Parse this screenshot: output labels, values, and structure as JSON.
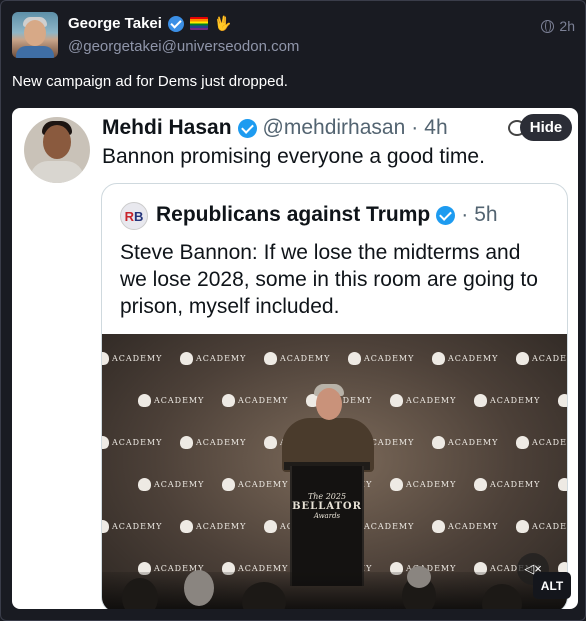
{
  "post": {
    "display_name": "George Takei",
    "handle": "@georgetakei@universeodon.com",
    "time": "2h",
    "text": "New campaign ad for Dems just dropped.",
    "icons": [
      "verified-badge-icon",
      "rainbow-flag-icon",
      "vulcan-salute-icon",
      "globe-icon"
    ]
  },
  "media": {
    "hide_label": "Hide",
    "alt_label": "ALT",
    "tweet": {
      "name": "Mehdi Hasan",
      "handle": "@mehdirhasan",
      "dot": "·",
      "time": "4h",
      "text": "Bannon promising everyone a good time."
    },
    "quote": {
      "avatar_text_r": "R",
      "avatar_text_b": "B",
      "name": "Republicans against Trump",
      "dot": "·",
      "time": "5h",
      "text": "Steve Bannon: If we lose the midterms and we lose 2028, some in this room are going to prison, myself included."
    },
    "photo": {
      "backdrop_text": "ACADEMY",
      "podium_line1": "The 2025",
      "podium_line2": "BELLATOR",
      "podium_line3": "Awards"
    }
  },
  "colors": {
    "background": "#191b22",
    "verified": "#1d9bf0",
    "muted_text": "#8f95a9"
  }
}
